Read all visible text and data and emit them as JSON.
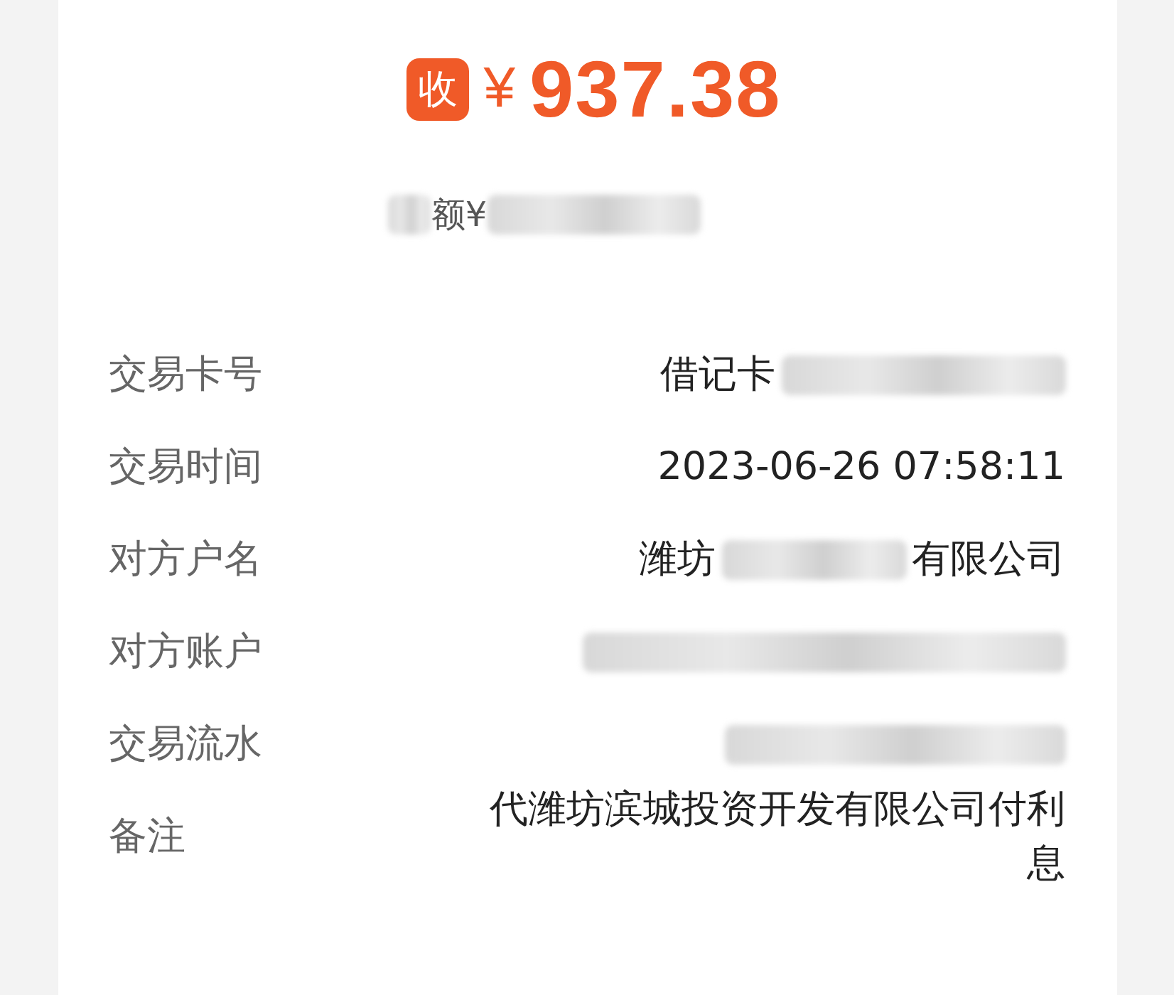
{
  "header": {
    "badge": "收",
    "currency": "¥",
    "amount": "937.38"
  },
  "balance": [
    {
      "kind": "blur"
    },
    {
      "kind": "text",
      "text": "额¥"
    },
    {
      "kind": "blur"
    }
  ],
  "rows": [
    {
      "label": "交易卡号",
      "value": [
        {
          "kind": "text",
          "text": "借记卡"
        },
        {
          "kind": "blur"
        }
      ]
    },
    {
      "label": "交易时间",
      "value": [
        {
          "kind": "text",
          "text": "2023-06-26 07:58:11"
        }
      ]
    },
    {
      "label": "对方户名",
      "value": [
        {
          "kind": "text",
          "text": "潍坊"
        },
        {
          "kind": "blur"
        },
        {
          "kind": "text",
          "text": "有限公司"
        }
      ]
    },
    {
      "label": "对方账户",
      "value": [
        {
          "kind": "blur"
        }
      ]
    },
    {
      "label": "交易流水",
      "value": [
        {
          "kind": "blur"
        }
      ]
    },
    {
      "label": "备注",
      "value": [
        {
          "kind": "note",
          "text": "代潍坊滨城投资开发有限公司付利息"
        }
      ]
    }
  ]
}
